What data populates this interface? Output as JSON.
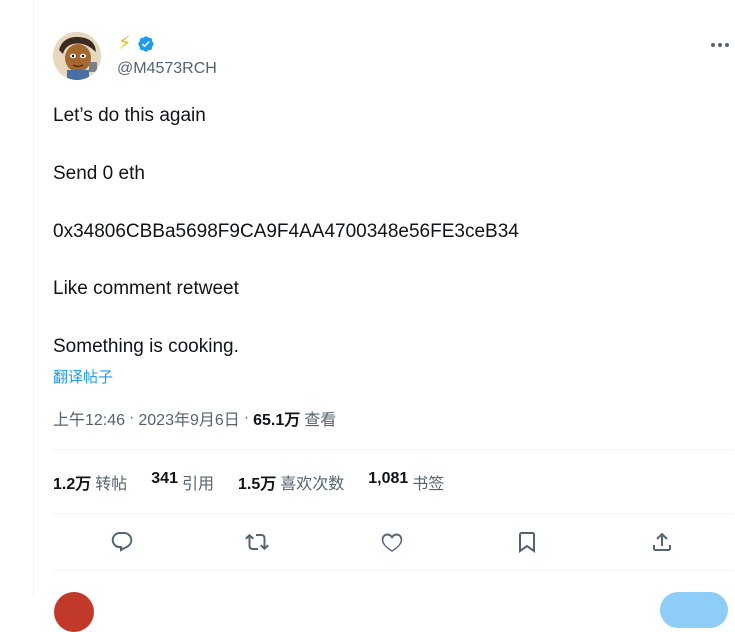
{
  "tweet": {
    "display_name_icon": "⚡",
    "handle": "@M4573RCH",
    "content_lines": [
      "Let’s do this again",
      "Send 0 eth",
      "0x34806CBBa5698F9CA9F4AA4700348e56FE3ceB34",
      "Like comment retweet",
      "Something is cooking."
    ],
    "translate_label": "翻译帖子",
    "time": "上午12:46",
    "separator": "·",
    "date": "2023年9月6日",
    "views_count": "65.1万",
    "views_label": "查看"
  },
  "stats": [
    {
      "count": "1.2万",
      "label": "转帖"
    },
    {
      "count": "341",
      "label": "引用"
    },
    {
      "count": "1.5万",
      "label": "喜欢次数"
    },
    {
      "count": "1,081",
      "label": "书签"
    }
  ],
  "colors": {
    "accent": "#1d9bf0",
    "text": "#0f1419",
    "muted": "#536471",
    "border": "#eff3f4"
  },
  "icons": {
    "verified": "verified-badge-icon",
    "more": "more-icon",
    "reply": "reply-icon",
    "retweet": "retweet-icon",
    "like": "heart-icon",
    "bookmark": "bookmark-icon",
    "share": "share-icon"
  }
}
